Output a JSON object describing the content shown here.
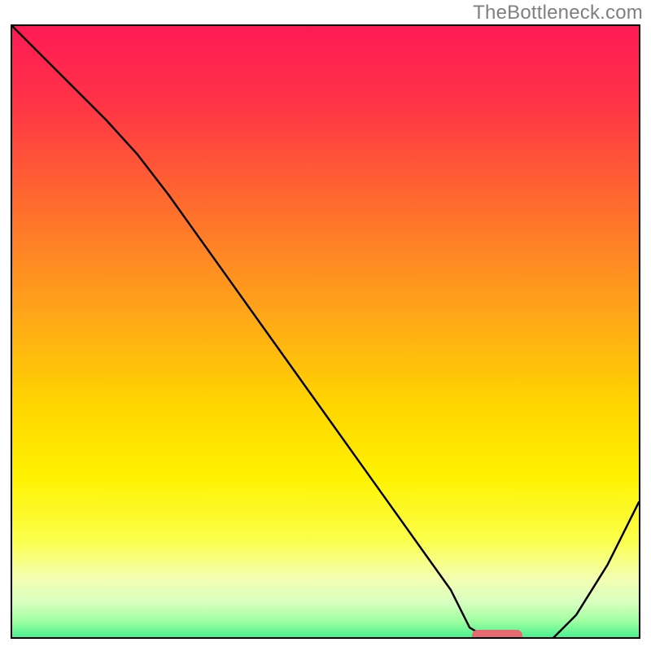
{
  "watermark": "TheBottleneck.com",
  "chart_data": {
    "type": "line",
    "title": "",
    "xlabel": "",
    "ylabel": "",
    "xlim": [
      0,
      100
    ],
    "ylim": [
      0,
      100
    ],
    "x": [
      0,
      5,
      10,
      15,
      20,
      25,
      30,
      35,
      40,
      45,
      50,
      55,
      60,
      65,
      70,
      73,
      78,
      82,
      85,
      90,
      95,
      100
    ],
    "values": [
      100,
      95,
      90,
      85,
      79.5,
      73,
      66,
      59,
      52,
      45,
      38,
      31,
      24,
      17,
      10,
      4,
      1,
      0.5,
      1,
      6,
      14,
      24
    ],
    "gradient_stops": [
      {
        "pos": 0.0,
        "color": "#ff1a55"
      },
      {
        "pos": 0.12,
        "color": "#ff3247"
      },
      {
        "pos": 0.28,
        "color": "#ff6a2e"
      },
      {
        "pos": 0.45,
        "color": "#ffa31a"
      },
      {
        "pos": 0.6,
        "color": "#ffd400"
      },
      {
        "pos": 0.72,
        "color": "#fff200"
      },
      {
        "pos": 0.82,
        "color": "#fbff4a"
      },
      {
        "pos": 0.88,
        "color": "#f4ffb0"
      },
      {
        "pos": 0.92,
        "color": "#d8ffc0"
      },
      {
        "pos": 0.95,
        "color": "#9effa0"
      },
      {
        "pos": 0.975,
        "color": "#4cf090"
      },
      {
        "pos": 1.0,
        "color": "#00e07a"
      }
    ],
    "marker": {
      "x_start": 73,
      "x_end": 81,
      "y": 0.8
    }
  }
}
